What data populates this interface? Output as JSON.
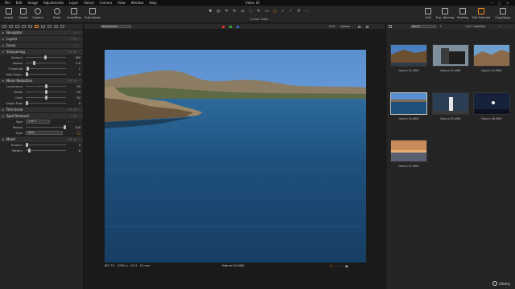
{
  "menu": {
    "items": [
      "File",
      "Edit",
      "Image",
      "Adjustments",
      "Layer",
      "Select",
      "Camera",
      "View",
      "Window",
      "Help"
    ],
    "window_title": "Video 16"
  },
  "toolbar": {
    "left": [
      "Import",
      "Export",
      "Capture"
    ],
    "mid": [
      "Reset",
      "Undo/Redo",
      "Auto Adjust"
    ],
    "cursor_label": "Cursor Tools",
    "right": [
      "Grid",
      "Exp. Warning",
      "Proofing",
      "Edit Selected",
      "Copy/Apply"
    ]
  },
  "left_panel": {
    "sections": {
      "navigator": "Navigator",
      "layers": "Layers",
      "focus": "Focus",
      "sharpening": "Sharpening",
      "noise_reduction": "Noise Reduction",
      "film_grain": "Film Grain",
      "spot_removal": "Spot Removal",
      "moire": "Moiré"
    },
    "sharpening": [
      {
        "label": "Amount",
        "value": "180",
        "level": 0.48
      },
      {
        "label": "Radius",
        "value": "0.8",
        "level": 0.2
      },
      {
        "label": "Threshold",
        "value": "1",
        "level": 0.02
      },
      {
        "label": "Halo Suppr.",
        "value": "0",
        "level": 0.0
      }
    ],
    "noise": [
      {
        "label": "Luminance",
        "value": "50",
        "level": 0.5
      },
      {
        "label": "Detail",
        "value": "50",
        "level": 0.5
      },
      {
        "label": "Color",
        "value": "50",
        "level": 0.5
      },
      {
        "label": "Single Pixel",
        "value": "0",
        "level": 0.0
      }
    ],
    "spot": {
      "spot_label": "Spot",
      "spot_value": "1 of 1",
      "radius_label": "Radius",
      "radius_value": "100",
      "type_label": "Type",
      "type_value": "Spot"
    },
    "moire": [
      {
        "label": "Amount",
        "value": "0",
        "level": 0.0
      },
      {
        "label": "Pattern",
        "value": "8",
        "level": 0.06
      }
    ]
  },
  "viewer": {
    "background_select": "Background",
    "zoom": "21%",
    "iso": "ISO 70",
    "shutter": "1/200 s",
    "aperture": "f/5.3",
    "focal": "24 mm",
    "filename": "Nature 04.ARW",
    "page": "1"
  },
  "browser": {
    "sort_select": "Name",
    "count": "1 of 7 selected",
    "thumbs": [
      {
        "caption": "Nature 01.ARW"
      },
      {
        "caption": "Nature 02.ARW"
      },
      {
        "caption": "Nature 03.ARW"
      },
      {
        "caption": "Nature 04.ARW",
        "selected": true
      },
      {
        "caption": "Nature 05.ARW"
      },
      {
        "caption": "Nature 06.ARW"
      },
      {
        "caption": "Nature 07.ARW"
      }
    ]
  },
  "watermark": "Udemy",
  "colors": {
    "accent": "#f08a1c",
    "panel": "#242424",
    "background": "#1a1a1a"
  }
}
